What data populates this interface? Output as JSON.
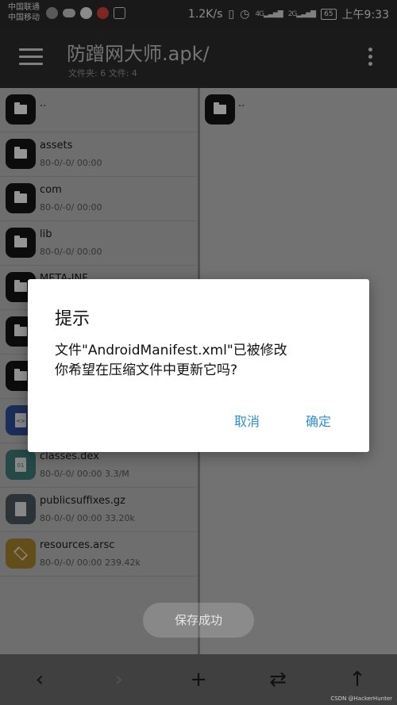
{
  "status_bar": {
    "carrier_1": "中国联通",
    "carrier_2": "中国移动",
    "speed": "1.2K/s",
    "net_1": "4G",
    "net_2": "2G",
    "battery": "65",
    "time": "上午9:33"
  },
  "toolbar": {
    "title": "防蹭网大师.apk/",
    "subtitle": "文件夹: 6  文件: 4"
  },
  "left_pane": {
    "items": [
      {
        "name": "..",
        "meta": "",
        "kind": "folder"
      },
      {
        "name": "assets",
        "meta": "80-0/-0/ 00:00",
        "kind": "folder"
      },
      {
        "name": "com",
        "meta": "80-0/-0/ 00:00",
        "kind": "folder"
      },
      {
        "name": "lib",
        "meta": "80-0/-0/ 00:00",
        "kind": "folder"
      },
      {
        "name": "META-INF",
        "meta": "",
        "kind": "folder"
      },
      {
        "name": "",
        "meta": "",
        "kind": "folder"
      },
      {
        "name": "",
        "meta": "",
        "kind": "folder"
      },
      {
        "name": "",
        "meta": "",
        "kind": "xml"
      },
      {
        "name": "classes.dex",
        "meta": "80-0/-0/ 00:00  3.3/M",
        "kind": "dex"
      },
      {
        "name": "publicsuffixes.gz",
        "meta": "80-0/-0/ 00:00  33.20k",
        "kind": "file"
      },
      {
        "name": "resources.arsc",
        "meta": "80-0/-0/ 00:00  239.42k",
        "kind": "arsc"
      }
    ]
  },
  "right_pane": {
    "items": [
      {
        "name": ".."
      }
    ]
  },
  "dialog": {
    "title": "提示",
    "message_line1": "文件\"AndroidManifest.xml\"已被修改",
    "message_line2": "你希望在压缩文件中更新它吗?",
    "cancel": "取消",
    "confirm": "确定"
  },
  "toast": "保存成功",
  "bottom_bar": {
    "back": "‹",
    "forward": "›",
    "add": "+",
    "swap": "⇄",
    "up": "↑"
  },
  "watermark": "CSDN @HackerHunter"
}
